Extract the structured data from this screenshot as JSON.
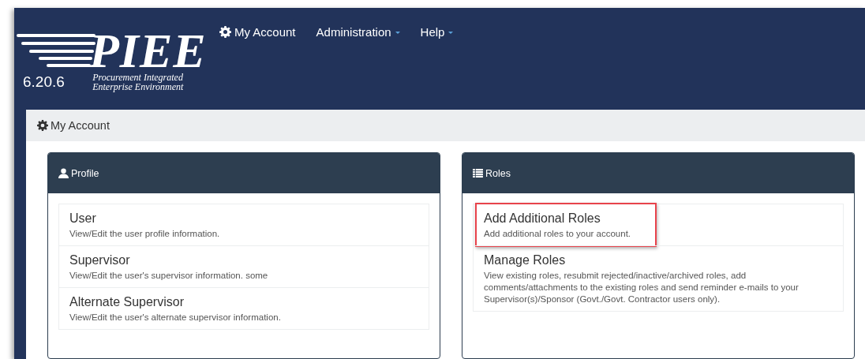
{
  "logo": {
    "title": "PIEE",
    "version": "6.20.6",
    "subtitle": [
      "Procurement Integrated",
      "Enterprise Environment"
    ]
  },
  "nav": [
    {
      "label": "My Account",
      "kind": "gear",
      "dropdown": false
    },
    {
      "label": "Administration",
      "kind": "plain",
      "dropdown": true
    },
    {
      "label": "Help",
      "kind": "plain",
      "dropdown": true
    }
  ],
  "page_heading": "My Account",
  "panels": [
    {
      "title": "Profile",
      "kind": "user",
      "items": [
        {
          "title": "User",
          "description": "View/Edit the user profile information.",
          "highlighted": false
        },
        {
          "title": "Supervisor",
          "description": "View/Edit the user's supervisor information. some",
          "highlighted": false
        },
        {
          "title": "Alternate Supervisor",
          "description": "View/Edit the user's alternate supervisor information.",
          "highlighted": false
        }
      ]
    },
    {
      "title": "Roles",
      "kind": "list",
      "items": [
        {
          "title": "Add Additional Roles",
          "description": "Add additional roles to your account.",
          "highlighted": true
        },
        {
          "title": "Manage Roles",
          "description": "View existing roles, resubmit rejected/inactive/archived roles, add comments/attachments to the existing roles and send reminder e-mails to your Supervisor(s)/Sponsor (Govt./Govt. Contractor users only).",
          "highlighted": false
        }
      ]
    }
  ]
}
